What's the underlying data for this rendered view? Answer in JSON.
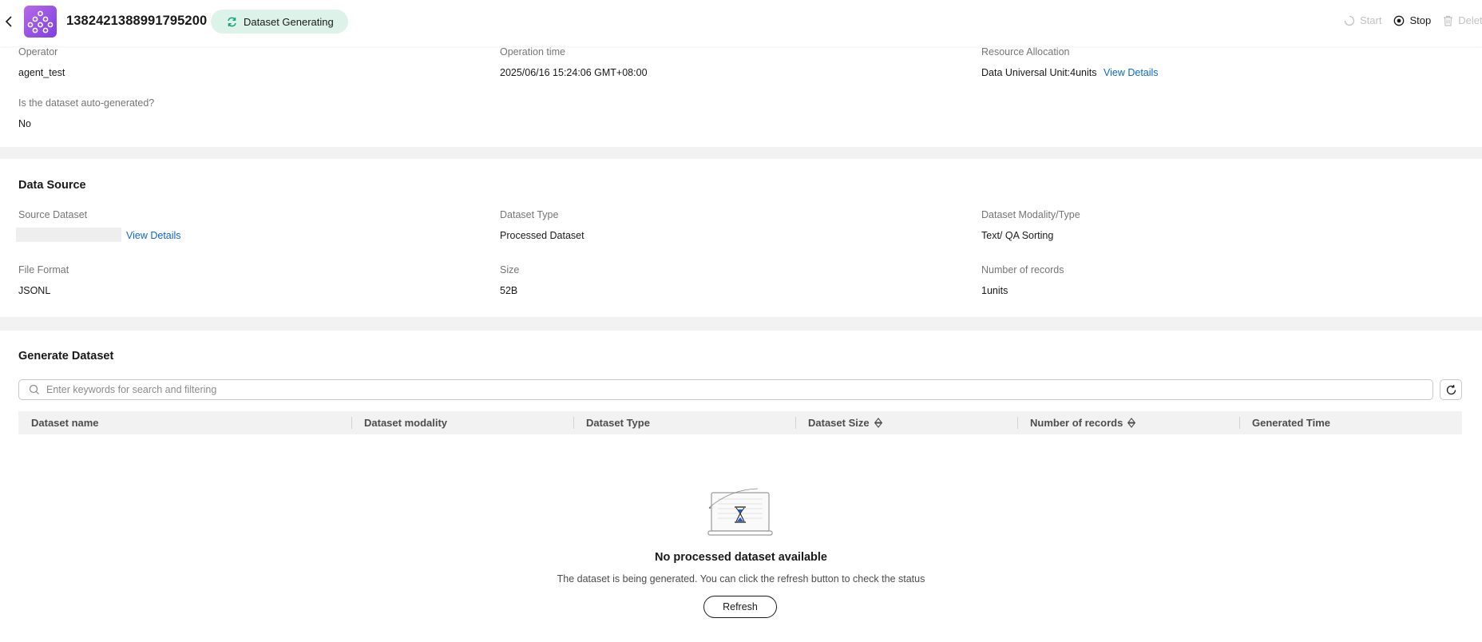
{
  "header": {
    "title": "1382421388991795200",
    "status": "Dataset Generating",
    "actions": {
      "start": "Start",
      "stop": "Stop",
      "delete": "Delete"
    }
  },
  "basic": {
    "operator_label": "Operator",
    "operator_value": "agent_test",
    "operation_time_label": "Operation time",
    "operation_time_value": "2025/06/16 15:24:06 GMT+08:00",
    "resource_label": "Resource Allocation",
    "resource_value": "Data Universal Unit:4units",
    "resource_link": "View Details",
    "auto_generated_label": "Is the dataset auto-generated?",
    "auto_generated_value": "No"
  },
  "data_source": {
    "title": "Data Source",
    "source_dataset_label": "Source Dataset",
    "source_dataset_link": "View Details",
    "dataset_type_label": "Dataset Type",
    "dataset_type_value": "Processed Dataset",
    "modality_label": "Dataset Modality/Type",
    "modality_value": "Text/ QA Sorting",
    "file_format_label": "File Format",
    "file_format_value": "JSONL",
    "size_label": "Size",
    "size_value": "52B",
    "records_label": "Number of records",
    "records_value": "1units"
  },
  "generate": {
    "title": "Generate Dataset",
    "search_placeholder": "Enter keywords for search and filtering",
    "columns": [
      "Dataset name",
      "Dataset modality",
      "Dataset Type",
      "Dataset Size",
      "Number of records",
      "Generated Time"
    ],
    "empty_title": "No processed dataset available",
    "empty_desc": "The dataset is being generated. You can click the refresh button to check the status",
    "refresh_label": "Refresh"
  },
  "colors": {
    "accent": "#0d66d8",
    "status_bg": "#ddf3ea",
    "status_icon": "#14a37f",
    "logo": "#9b55e3"
  },
  "icons": [
    "chevron-left-icon",
    "app-logo-icon",
    "sync-icon",
    "start-icon",
    "stop-icon",
    "trash-icon",
    "search-icon",
    "refresh-icon",
    "sort-icon",
    "empty-laptop-illustration"
  ]
}
